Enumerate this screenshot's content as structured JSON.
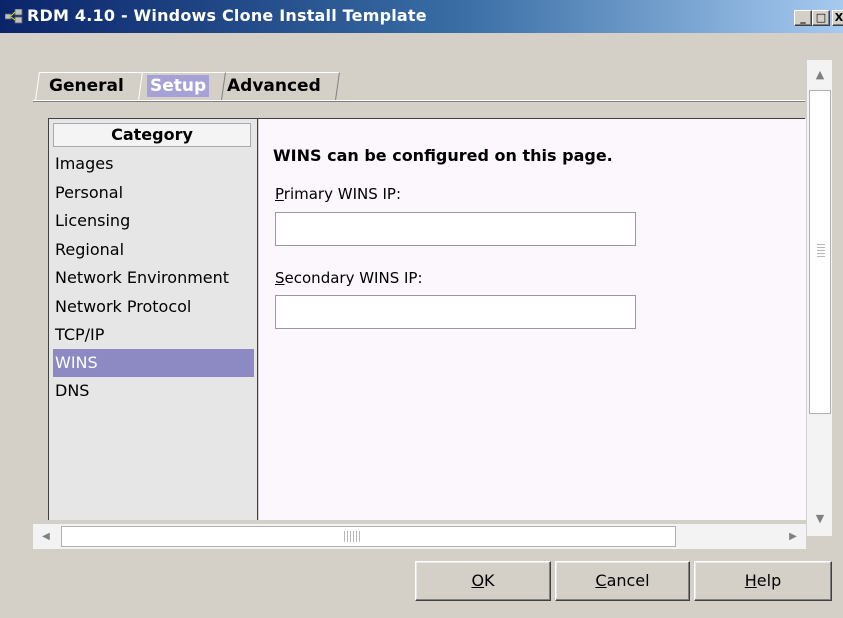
{
  "window": {
    "title": "RDM 4.10 - Windows Clone Install Template",
    "minimize_glyph": "_",
    "maximize_glyph": "□",
    "close_glyph": "X"
  },
  "tabs": [
    {
      "label": "General",
      "selected": false
    },
    {
      "label": "Setup",
      "selected": true
    },
    {
      "label": "Advanced",
      "selected": false
    }
  ],
  "category": {
    "header": "Category",
    "items": [
      {
        "label": "Images"
      },
      {
        "label": "Personal"
      },
      {
        "label": "Licensing"
      },
      {
        "label": "Regional"
      },
      {
        "label": "Network Environment"
      },
      {
        "label": "Network Protocol"
      },
      {
        "label": "TCP/IP"
      },
      {
        "label": "WINS",
        "selected": true
      },
      {
        "label": "DNS"
      }
    ]
  },
  "content": {
    "heading": "WINS can be configured on this page.",
    "primary": {
      "label_mnemonic": "P",
      "label_rest": "rimary WINS IP:",
      "value": ""
    },
    "secondary": {
      "label_mnemonic": "S",
      "label_rest": "econdary WINS IP:",
      "value": ""
    }
  },
  "buttons": {
    "ok": {
      "mnemonic": "O",
      "rest": "K"
    },
    "cancel": {
      "mnemonic": "C",
      "rest": "ancel"
    },
    "help": {
      "mnemonic": "H",
      "rest": "elp"
    }
  },
  "icons": {
    "app": "network-computers-icon",
    "scroll_up": "▲",
    "scroll_down": "▼",
    "scroll_left": "◀",
    "scroll_right": "▶"
  },
  "colors": {
    "selected_bg": "#8d89c3",
    "title_start": "#0a246a"
  }
}
